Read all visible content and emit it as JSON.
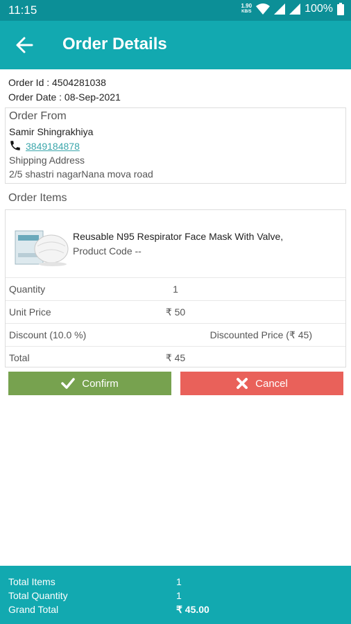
{
  "status_bar": {
    "time": "11:15",
    "speed": "1.90",
    "speed_unit": "KB/S",
    "battery": "100%"
  },
  "app_bar": {
    "title": "Order Details"
  },
  "order": {
    "id_label": "Order Id : 4504281038",
    "date_label": "Order Date : 08-Sep-2021"
  },
  "order_from": {
    "title": "Order From",
    "name": "Samir Shingrakhiya",
    "phone": "3849184878",
    "shipping_label": "Shipping Address",
    "address": "2/5 shastri nagarNana mova road"
  },
  "order_items": {
    "title": "Order Items",
    "product_name": "Reusable N95 Respirator Face Mask With Valve,",
    "product_code": "Product Code --",
    "rows": [
      {
        "label": "Quantity",
        "value": "1"
      },
      {
        "label": "Unit Price",
        "value": "₹ 50"
      },
      {
        "label": "Discount (10.0 %)",
        "value": "Discounted Price (₹ 45)"
      },
      {
        "label": "Total",
        "value": "₹ 45"
      }
    ]
  },
  "actions": {
    "confirm": "Confirm",
    "cancel": "Cancel",
    "confirm_color": "#77a24f",
    "cancel_color": "#e9615a"
  },
  "footer": {
    "total_items_label": "Total Items",
    "total_items": "1",
    "total_quantity_label": "Total Quantity",
    "total_quantity": "1",
    "grand_total_label": "Grand Total",
    "grand_total": "₹ 45.00"
  },
  "colors": {
    "primary": "#12a9b0",
    "status_bar": "#0c8f97",
    "link": "#3aa6ab"
  }
}
